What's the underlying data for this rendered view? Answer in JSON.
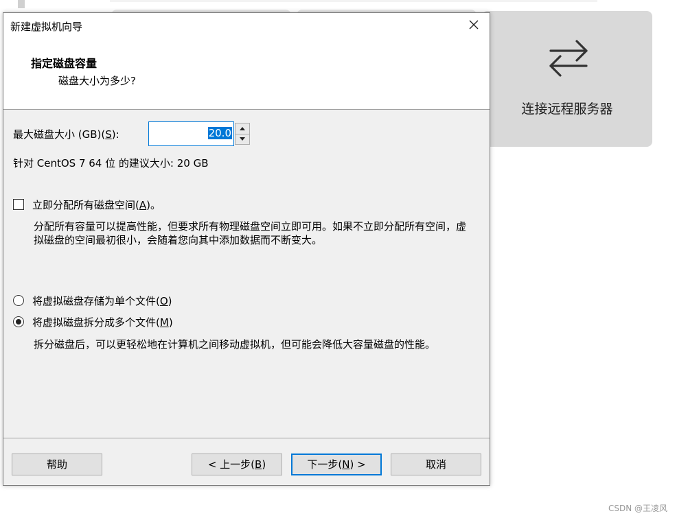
{
  "background": {
    "card_label": "连接远程服务器",
    "watermark": "CSDN @王凌风"
  },
  "dialog": {
    "title": "新建虚拟机向导",
    "header_title": "指定磁盘容量",
    "header_subtitle": "磁盘大小为多少?",
    "max_size_label_prefix": "最大磁盘大小 (GB)(",
    "max_size_label_key": "S",
    "max_size_label_suffix": "):",
    "max_size_value": "20.0",
    "recommended_text": "针对 CentOS 7 64 位 的建议大小: 20 GB",
    "allocate_label_prefix": "立即分配所有磁盘空间(",
    "allocate_label_key": "A",
    "allocate_label_suffix": ")。",
    "allocate_checked": false,
    "allocate_desc": "分配所有容量可以提高性能，但要求所有物理磁盘空间立即可用。如果不立即分配所有空间，虚拟磁盘的空间最初很小，会随着您向其中添加数据而不断变大。",
    "option_single_prefix": "将虚拟磁盘存储为单个文件(",
    "option_single_key": "O",
    "option_single_suffix": ")",
    "option_multi_prefix": "将虚拟磁盘拆分成多个文件(",
    "option_multi_key": "M",
    "option_multi_suffix": ")",
    "selected_option": "multi",
    "multi_desc": "拆分磁盘后，可以更轻松地在计算机之间移动虚拟机，但可能会降低大容量磁盘的性能。",
    "buttons": {
      "help": "帮助",
      "back_prefix": "< 上一步(",
      "back_key": "B",
      "back_suffix": ")",
      "next_prefix": "下一步(",
      "next_key": "N",
      "next_suffix": ") >",
      "cancel": "取消"
    }
  },
  "colors": {
    "accent": "#0078d7",
    "dialog_body": "#f0f0f0",
    "background_card": "#d9d9d9"
  }
}
